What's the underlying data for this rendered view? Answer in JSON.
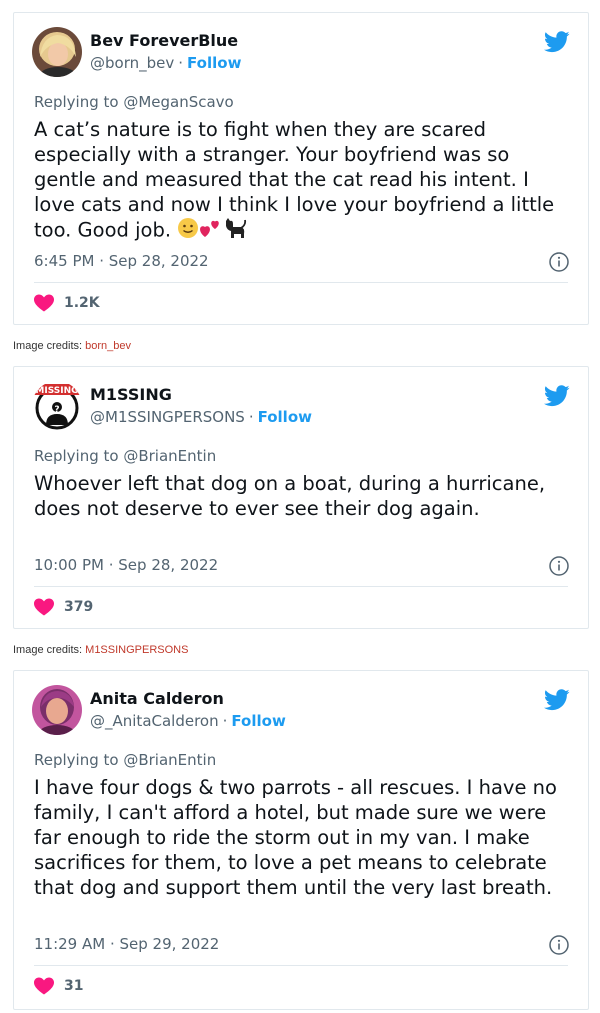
{
  "colors": {
    "accent": "#1d9bf0",
    "heart": "#f91880",
    "muted": "#536471",
    "credit_link": "#c0392b"
  },
  "tweets": [
    {
      "name": "Bev ForeverBlue",
      "handle": "@born_bev",
      "follow": "Follow",
      "replying": "Replying to @MeganScavo",
      "text": "A cat’s nature is to fight when they are scared especially with a stranger. Your boyfriend was so gentle and measured that the cat read his intent. I love cats and now I think I love your boyfriend a little too. Good job.",
      "time": "6:45 PM · Sep 28, 2022",
      "likes": "1.2K"
    },
    {
      "name": "M1SSING",
      "handle": "@M1SSINGPERSONS",
      "follow": "Follow",
      "replying": "Replying to @BrianEntin",
      "text": "Whoever left that dog on a boat, during a hurricane, does not deserve to ever see their dog again.",
      "time": "10:00 PM · Sep 28, 2022",
      "likes": "379",
      "avatar_text": "MISSING"
    },
    {
      "name": "Anita Calderon",
      "handle": "@_AnitaCalderon",
      "follow": "Follow",
      "replying": "Replying to @BrianEntin",
      "text": "I have four dogs & two parrots - all rescues. I have no family, I can't afford a hotel, but made sure we were far enough to ride the storm out in my van. I make sacrifices for them, to love a pet means to celebrate that dog and support them until the very last breath.",
      "time": "11:29 AM · Sep 29, 2022",
      "likes": "31"
    }
  ],
  "credits": [
    {
      "label": "Image credits:",
      "link": "born_bev"
    },
    {
      "label": "Image credits:",
      "link": "M1SSINGPERSONS"
    }
  ]
}
